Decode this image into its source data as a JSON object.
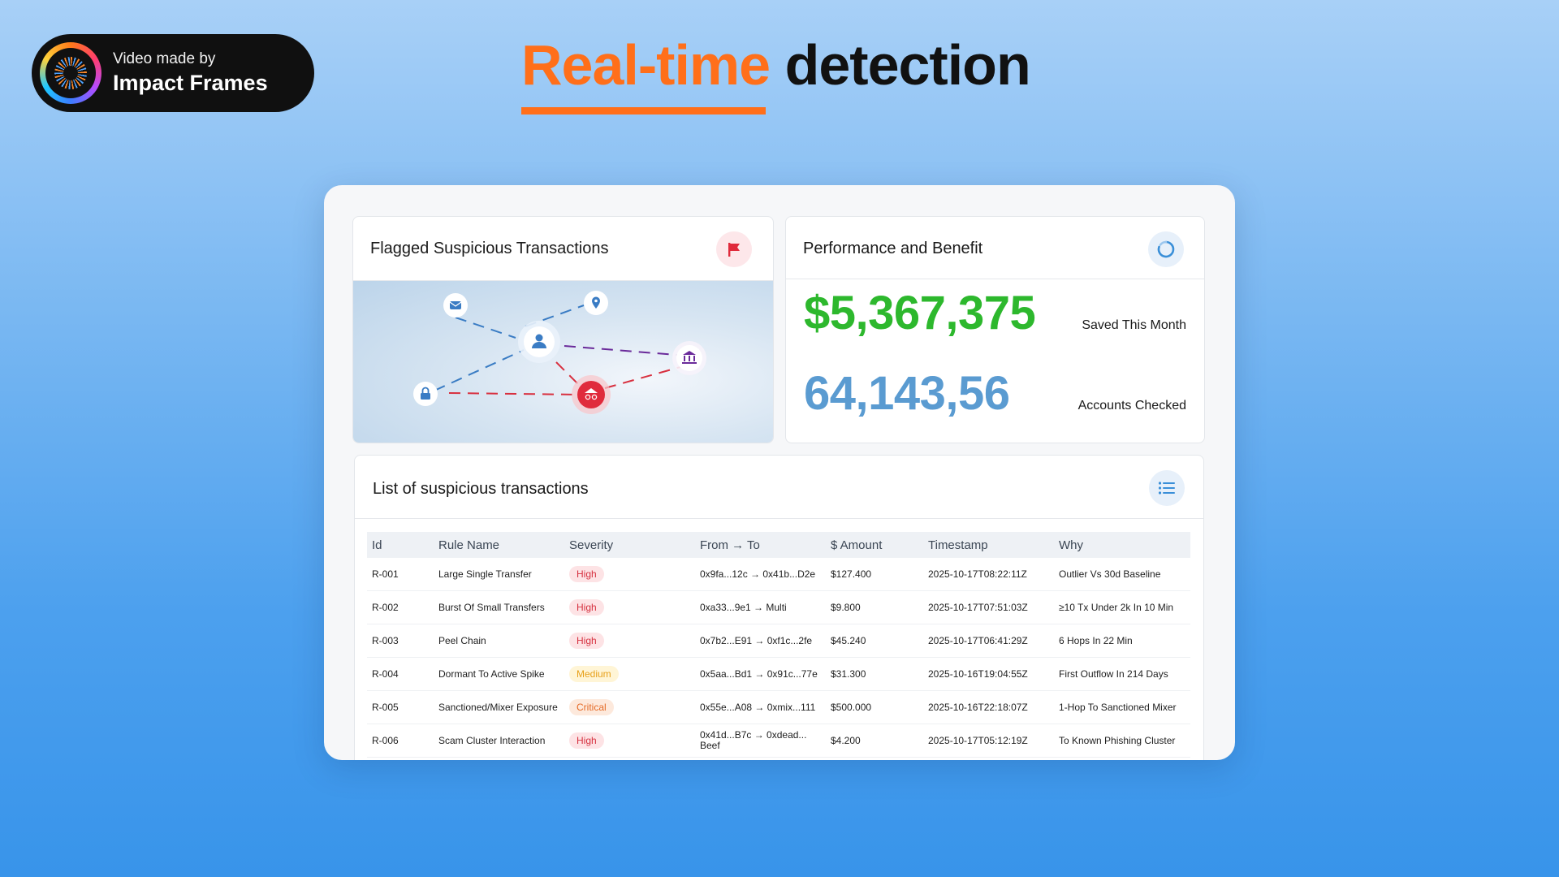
{
  "badge": {
    "small": "Video made by",
    "big": "Impact Frames"
  },
  "heading": {
    "accent": "Real-time",
    "rest": "detection"
  },
  "flagged_card": {
    "title": "Flagged Suspicious Transactions",
    "icon": "flag-icon"
  },
  "performance_card": {
    "title": "Performance and Benefit",
    "icon": "refresh-icon",
    "saved_value": "$5,367,375",
    "saved_label": "Saved This Month",
    "checked_value": "64,143,56",
    "checked_label": "Accounts Checked"
  },
  "list_card": {
    "title": "List of suspicious transactions",
    "icon": "list-icon",
    "columns": [
      "Id",
      "Rule Name",
      "Severity",
      "From → To",
      "$ Amount",
      "Timestamp",
      "Why"
    ],
    "rows": [
      {
        "id": "R-001",
        "rule": "Large Single Transfer",
        "severity": "High",
        "from_to": "0x9fa...12c → 0x41b...D2e",
        "amount": "$127.400",
        "timestamp": "2025-10-17T08:22:11Z",
        "why": "Outlier Vs 30d Baseline"
      },
      {
        "id": "R-002",
        "rule": "Burst Of Small Transfers",
        "severity": "High",
        "from_to": "0xa33...9e1 → Multi",
        "amount": "$9.800",
        "timestamp": "2025-10-17T07:51:03Z",
        "why": "≥10 Tx Under 2k In 10 Min"
      },
      {
        "id": "R-003",
        "rule": "Peel Chain",
        "severity": "High",
        "from_to": "0x7b2...E91 → 0xf1c...2fe",
        "amount": "$45.240",
        "timestamp": "2025-10-17T06:41:29Z",
        "why": "6 Hops In 22 Min"
      },
      {
        "id": "R-004",
        "rule": "Dormant To Active Spike",
        "severity": "Medium",
        "from_to": "0x5aa...Bd1 → 0x91c...77e",
        "amount": "$31.300",
        "timestamp": "2025-10-16T19:04:55Z",
        "why": "First Outflow In 214 Days"
      },
      {
        "id": "R-005",
        "rule": "Sanctioned/Mixer Exposure",
        "severity": "Critical",
        "from_to": "0x55e...A08 → 0xmix...111",
        "amount": "$500.000",
        "timestamp": "2025-10-16T22:18:07Z",
        "why": "1-Hop To Sanctioned Mixer"
      },
      {
        "id": "R-006",
        "rule": "Scam Cluster Interaction",
        "severity": "High",
        "from_to": "0x41d...B7c → 0xdead... Beef",
        "amount": "$4.200",
        "timestamp": "2025-10-17T05:12:19Z",
        "why": "To Known Phishing Cluster"
      }
    ]
  },
  "colors": {
    "accent": "#ff6f1a",
    "saved_green": "#2db82d",
    "checked_blue": "#5a9bd1",
    "high": "#d6303f",
    "medium": "#e7a01a",
    "critical": "#e56a26"
  },
  "network_icons": [
    "mail-icon",
    "location-pin-icon",
    "user-icon",
    "bank-icon",
    "lock-icon",
    "hacker-icon"
  ]
}
